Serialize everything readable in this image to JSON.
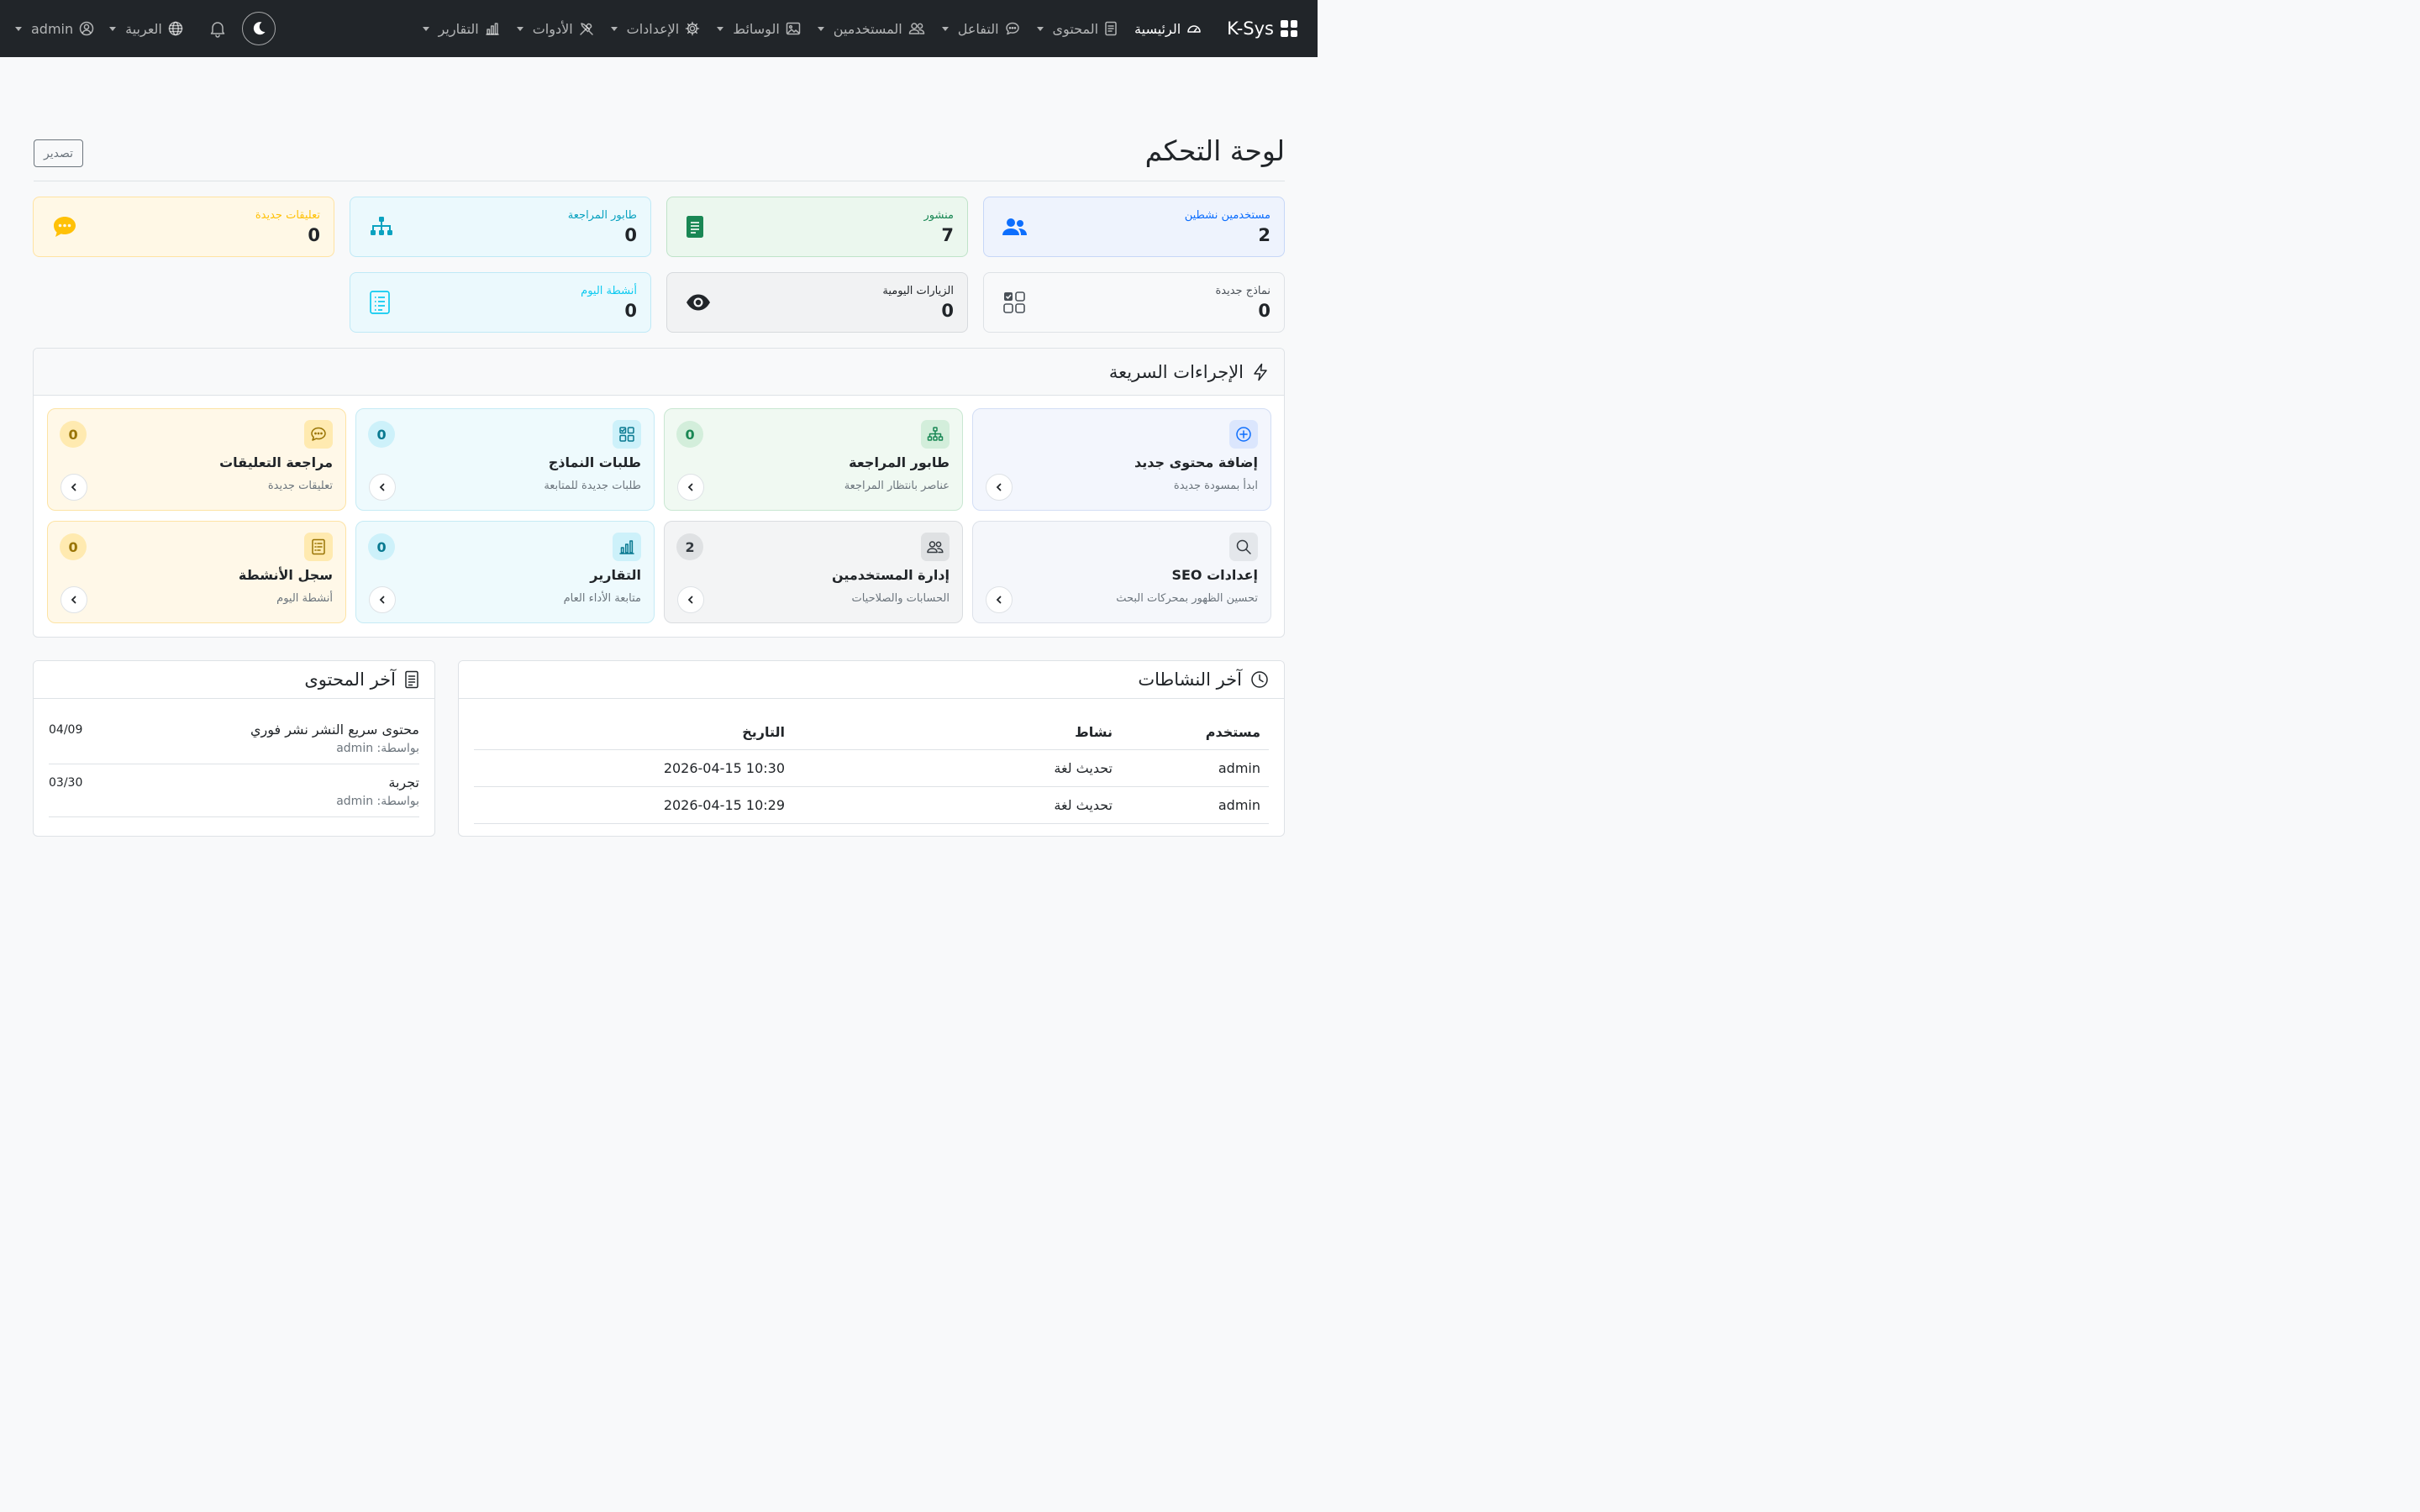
{
  "navbar": {
    "brand": "K-Sys",
    "items": [
      {
        "label": "الرئيسية"
      },
      {
        "label": "المحتوى"
      },
      {
        "label": "التفاعل"
      },
      {
        "label": "المستخدمين"
      },
      {
        "label": "الوسائط"
      },
      {
        "label": "الإعدادات"
      },
      {
        "label": "الأدوات"
      },
      {
        "label": "التقارير"
      }
    ],
    "language": "العربية",
    "user": "admin"
  },
  "header": {
    "title": "لوحة التحكم",
    "export_label": "تصدير"
  },
  "stats": [
    {
      "label": "مستخدمين نشطين",
      "value": "2",
      "icon": "users-icon"
    },
    {
      "label": "منشور",
      "value": "7",
      "icon": "document-icon"
    },
    {
      "label": "طابور المراجعة",
      "value": "0",
      "icon": "sitemap-icon"
    },
    {
      "label": "تعليقات جديدة",
      "value": "0",
      "icon": "comment-icon"
    },
    {
      "label": "نماذج جديدة",
      "value": "0",
      "icon": "grid-icon"
    },
    {
      "label": "الزيارات اليومية",
      "value": "0",
      "icon": "eye-icon"
    },
    {
      "label": "أنشطة اليوم",
      "value": "0",
      "icon": "list-icon"
    }
  ],
  "quick_actions": {
    "title": "الإجراءات السريعة",
    "items": [
      {
        "title": "إضافة محتوى جديد",
        "subtitle": "ابدأ بمسودة جديدة",
        "badge": ""
      },
      {
        "title": "طابور المراجعة",
        "subtitle": "عناصر بانتظار المراجعة",
        "badge": "0"
      },
      {
        "title": "طلبات النماذج",
        "subtitle": "طلبات جديدة للمتابعة",
        "badge": "0"
      },
      {
        "title": "مراجعة التعليقات",
        "subtitle": "تعليقات جديدة",
        "badge": "0"
      },
      {
        "title": "إعدادات SEO",
        "subtitle": "تحسين الظهور بمحركات البحث",
        "badge": ""
      },
      {
        "title": "إدارة المستخدمين",
        "subtitle": "الحسابات والصلاحيات",
        "badge": "2"
      },
      {
        "title": "التقارير",
        "subtitle": "متابعة الأداء العام",
        "badge": "0"
      },
      {
        "title": "سجل الأنشطة",
        "subtitle": "أنشطة اليوم",
        "badge": "0"
      }
    ]
  },
  "activities": {
    "title": "آخر النشاطات",
    "columns": [
      "مستخدم",
      "نشاط",
      "التاريخ"
    ],
    "rows": [
      {
        "user": "admin",
        "activity": "تحديث لغة",
        "date": "10:30 2026-04-15"
      },
      {
        "user": "admin",
        "activity": "تحديث لغة",
        "date": "10:29 2026-04-15"
      }
    ]
  },
  "latest_content": {
    "title": "آخر المحتوى",
    "items": [
      {
        "title": "محتوى سريع النشر نشر فوري",
        "by": "بواسطة: admin",
        "date": "04/09"
      },
      {
        "title": "تجربة",
        "by": "بواسطة: admin",
        "date": "03/30"
      }
    ]
  },
  "colors": {
    "navbar": "#212529",
    "primary": "#0d6efd",
    "success": "#198754",
    "info": "#0dcaf0",
    "warning": "#ffc107"
  }
}
